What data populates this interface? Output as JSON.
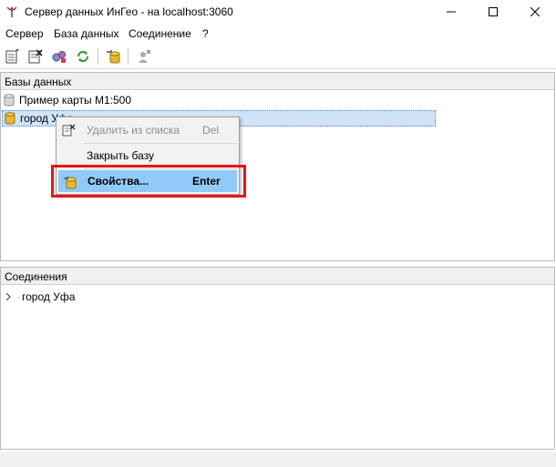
{
  "window": {
    "title": "Сервер данных ИнГео - на localhost:3060",
    "app_icon": "antenna-icon"
  },
  "menu": {
    "items": [
      "Сервер",
      "База данных",
      "Соединение",
      "?"
    ]
  },
  "toolbar": {
    "buttons": [
      "add-database-icon",
      "remove-database-icon",
      "connect-icon",
      "refresh-icon",
      "properties-icon",
      "disconnect-icon"
    ]
  },
  "databases_panel": {
    "header": "Базы данных",
    "items": [
      {
        "label": "Пример карты М1:500",
        "icon": "database-icon"
      },
      {
        "label": "город Уфа",
        "icon": "database-icon",
        "selected": true
      }
    ]
  },
  "context_menu": {
    "items": [
      {
        "label": "Удалить из списка",
        "shortcut": "Del",
        "disabled": true,
        "icon": "remove-database-icon"
      },
      {
        "label": "Закрыть базу",
        "shortcut": "",
        "disabled": false
      },
      {
        "label": "Свойства...",
        "shortcut": "Enter",
        "highlighted": true,
        "icon": "properties-icon"
      }
    ]
  },
  "connections_panel": {
    "header": "Соединения",
    "items": [
      {
        "label": "город Уфа",
        "expanded": false
      }
    ]
  },
  "colors": {
    "selection": "#cfe4f8",
    "menu_hover": "#91c9f7",
    "highlight_border": "#e8141b"
  }
}
